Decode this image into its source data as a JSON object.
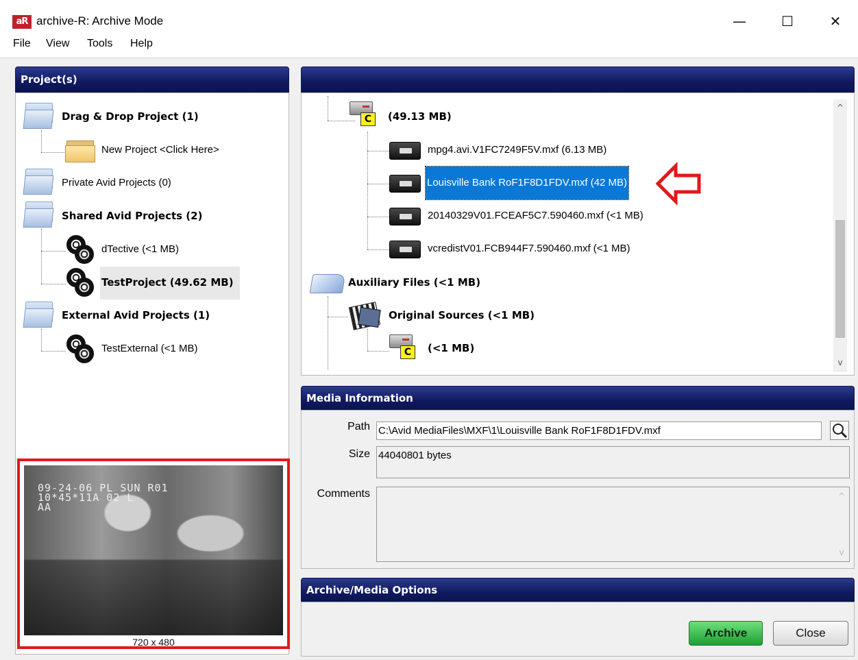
{
  "window": {
    "title": "archive-R: Archive Mode",
    "icon_text": "aR",
    "controls": {
      "minimize": "—",
      "maximize": "☐",
      "close": "✕"
    }
  },
  "menu": [
    "File",
    "View",
    "Tools",
    "Help"
  ],
  "projects_panel": {
    "header": "Project(s)",
    "items": [
      {
        "label": "Drag & Drop Project (1)",
        "icon": "blue-folder-icon"
      },
      {
        "label": "New Project <Click Here>",
        "icon": "yellow-folder-icon"
      },
      {
        "label": "Private Avid Projects (0)",
        "icon": "blue-folder-icon"
      },
      {
        "label": "Shared Avid Projects (2)",
        "icon": "blue-folder-icon"
      },
      {
        "label": "dTective (<1 MB)",
        "icon": "film-reel-icon"
      },
      {
        "label": "TestProject (49.62 MB)",
        "icon": "film-reel-icon",
        "selected": true
      },
      {
        "label": "External Avid Projects (1)",
        "icon": "blue-folder-icon"
      },
      {
        "label": "TestExternal (<1 MB)",
        "icon": "film-reel-icon"
      }
    ],
    "preview": {
      "osd_line1": "09-24-06 PL SUN R01",
      "osd_line2": "10*45*11A 02    L",
      "osd_line3": "AA",
      "caption": "720 x 480"
    }
  },
  "media_tree": {
    "header": "",
    "items": [
      {
        "label": "(49.13 MB)",
        "icon": "drive-c-icon"
      },
      {
        "label": "mpg4.avi.V1FC7249F5V.mxf (6.13 MB)",
        "icon": "media-file-icon"
      },
      {
        "label": "Louisville Bank RoF1F8D1FDV.mxf (42 MB)",
        "icon": "media-file-icon",
        "selected": true
      },
      {
        "label": "20140329V01.FCEAF5C7.590460.mxf (<1 MB)",
        "icon": "media-file-icon"
      },
      {
        "label": "vcredistV01.FCB944F7.590460.mxf (<1 MB)",
        "icon": "media-file-icon"
      },
      {
        "label": "Auxiliary Files (<1 MB)",
        "icon": "aux-folder-icon"
      },
      {
        "label": "Original Sources (<1 MB)",
        "icon": "original-sources-icon"
      },
      {
        "label": "(<1 MB)",
        "icon": "drive-c-icon"
      }
    ],
    "drive_letter": "C",
    "scroll": {
      "up": "^",
      "down": "v"
    }
  },
  "media_info": {
    "header": "Media Information",
    "path_label": "Path",
    "path_value": "C:\\Avid MediaFiles\\MXF\\1\\Louisville Bank RoF1F8D1FDV.mxf",
    "size_label": "Size",
    "size_value": "44040801 bytes",
    "comments_label": "Comments",
    "comments_value": ""
  },
  "options": {
    "header": "Archive/Media Options",
    "archive_label": "Archive",
    "close_label": "Close"
  },
  "colors": {
    "header_blue": "#0f1a5e",
    "selection": "#0a78d7",
    "archive_green": "#1f9e35",
    "annotation_red": "#e01a1a"
  }
}
